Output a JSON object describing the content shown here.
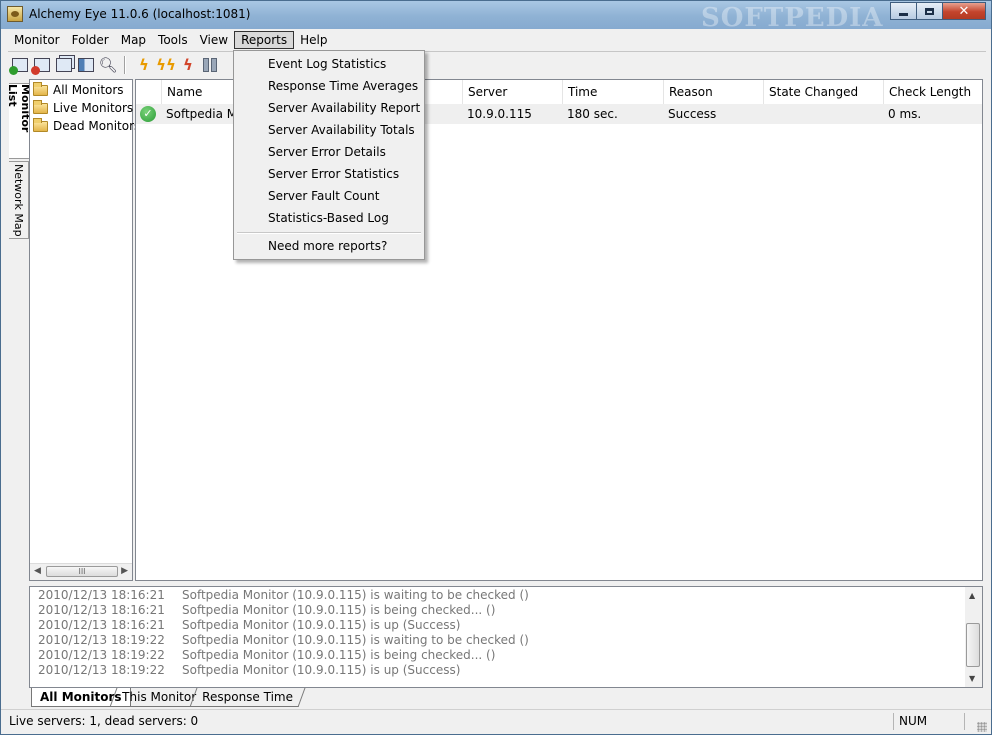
{
  "window": {
    "title": "Alchemy Eye 11.0.6 (localhost:1081)",
    "watermark": "SOFTPEDIA"
  },
  "menubar": {
    "items": [
      "Monitor",
      "Folder",
      "Map",
      "Tools",
      "View",
      "Reports",
      "Help"
    ],
    "active": "Reports"
  },
  "toolbar": {
    "buttons": [
      "add-monitor-icon",
      "delete-monitor-icon",
      "copy-monitor-icon",
      "properties-icon",
      "find-icon",
      "check-icon",
      "check-all-icon",
      "check-dead-icon",
      "pause-icon"
    ]
  },
  "side_tabs": {
    "monitor_list": "Monitor List",
    "network_map": "Network Map"
  },
  "tree": {
    "items": [
      {
        "label": "All Monitors",
        "icon": "folder-open-icon"
      },
      {
        "label": "Live Monitors",
        "icon": "folder-icon"
      },
      {
        "label": "Dead Monitors",
        "icon": "folder-icon"
      }
    ],
    "scroll_thumb": "III"
  },
  "list": {
    "columns": [
      "Name",
      "Server",
      "Time",
      "Reason",
      "State Changed",
      "Check Length"
    ],
    "rows": [
      {
        "status": "up",
        "name": "Softpedia Mo",
        "server": "10.9.0.115",
        "time": "180 sec.",
        "reason": "Success",
        "state_changed": "",
        "check_length": "0 ms."
      }
    ]
  },
  "reports_menu": {
    "items": [
      "Event Log Statistics",
      "Response Time Averages",
      "Server Availability Report",
      "Server Availability Totals",
      "Server Error Details",
      "Server Error Statistics",
      "Server Fault Count",
      "Statistics-Based Log"
    ],
    "more": "Need more reports?"
  },
  "log": {
    "lines": [
      {
        "ts": "2010/12/13 18:16:21",
        "msg": "Softpedia Monitor (10.9.0.115) is waiting to be checked ()"
      },
      {
        "ts": "2010/12/13 18:16:21",
        "msg": "Softpedia Monitor (10.9.0.115) is being checked... ()"
      },
      {
        "ts": "2010/12/13 18:16:21",
        "msg": "Softpedia Monitor (10.9.0.115) is up (Success)"
      },
      {
        "ts": "2010/12/13 18:19:22",
        "msg": "Softpedia Monitor (10.9.0.115) is waiting to be checked ()"
      },
      {
        "ts": "2010/12/13 18:19:22",
        "msg": "Softpedia Monitor (10.9.0.115) is being checked... ()"
      },
      {
        "ts": "2010/12/13 18:19:22",
        "msg": "Softpedia Monitor (10.9.0.115) is up (Success)"
      }
    ]
  },
  "bottom_tabs": [
    "All Monitors",
    "This Monitor",
    "Response Time"
  ],
  "status": {
    "servers": "Live servers: 1, dead servers: 0",
    "num": "NUM"
  }
}
